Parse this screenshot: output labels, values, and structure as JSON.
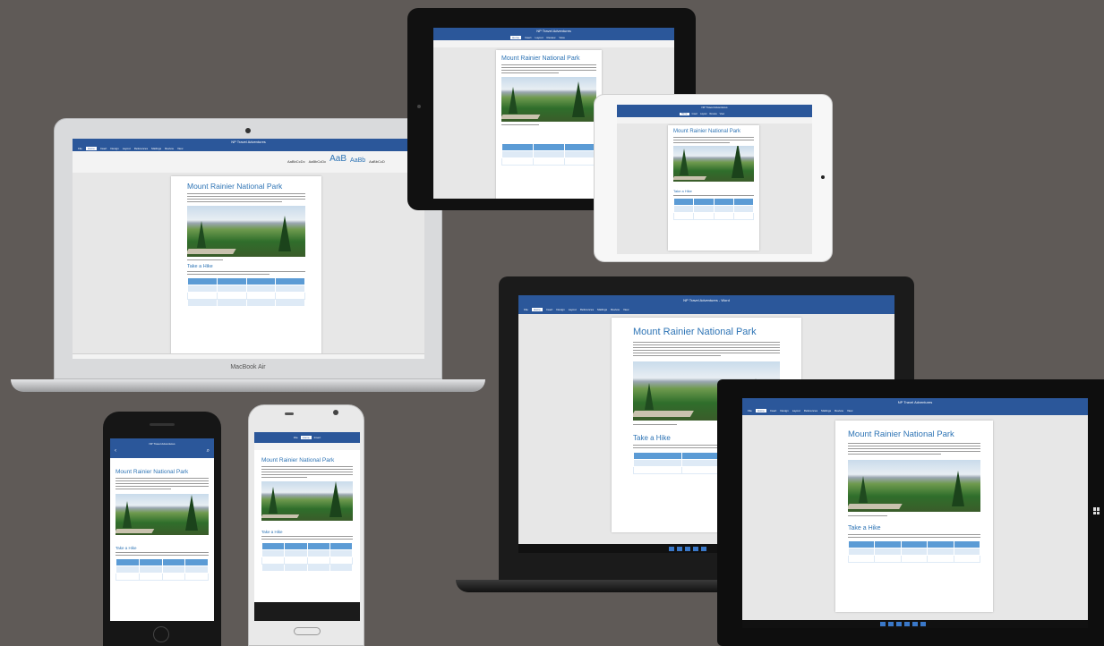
{
  "laptop": {
    "brand": "MacBook Air",
    "window_title": "NP Travel Adventures",
    "tabs": [
      "File",
      "Home",
      "Insert",
      "Design",
      "Layout",
      "References",
      "Mailings",
      "Review",
      "View"
    ],
    "style_samples": [
      "AaBbCcDc",
      "AaBbCcDc",
      "AaB",
      "AaBb",
      "AaBbCcD"
    ],
    "document": {
      "title": "Mount Rainier National Park",
      "heading": "Take a Hike"
    }
  },
  "ipad_dark": {
    "window_title": "NP Travel Adventures",
    "tabs": [
      "Home",
      "Insert",
      "Layout",
      "Review",
      "View"
    ],
    "document": {
      "title": "Mount Rainier National Park"
    }
  },
  "ipad_white": {
    "window_title": "NP Travel Adventures",
    "tabs": [
      "Home",
      "Insert",
      "Layout",
      "Review",
      "View"
    ],
    "document": {
      "title": "Mount Rainier National Park",
      "heading": "Take a Hike"
    }
  },
  "windows_laptop": {
    "window_title": "NP Travel Adventures - Word",
    "tabs": [
      "File",
      "Home",
      "Insert",
      "Design",
      "Layout",
      "References",
      "Mailings",
      "Review",
      "View"
    ],
    "document": {
      "title": "Mount Rainier National Park",
      "heading": "Take a Hike"
    }
  },
  "surface": {
    "window_title": "NP Travel Adventures",
    "tabs": [
      "File",
      "Home",
      "Insert",
      "Design",
      "Layout",
      "References",
      "Mailings",
      "Review",
      "View"
    ],
    "document": {
      "title": "Mount Rainier National Park",
      "heading": "Take a Hike"
    }
  },
  "iphone": {
    "window_title": "NP Travel Adventures",
    "document": {
      "title": "Mount Rainier National Park",
      "heading": "Take a Hike"
    }
  },
  "android": {
    "window_title": "NP Travel Adventures",
    "tabs": [
      "File",
      "Home",
      "Insert"
    ],
    "document": {
      "title": "Mount Rainier National Park",
      "heading": "Take a Hike"
    }
  },
  "colors": {
    "word_blue": "#2b579a",
    "heading_blue": "#2e74b5",
    "background": "#5f5a57"
  }
}
